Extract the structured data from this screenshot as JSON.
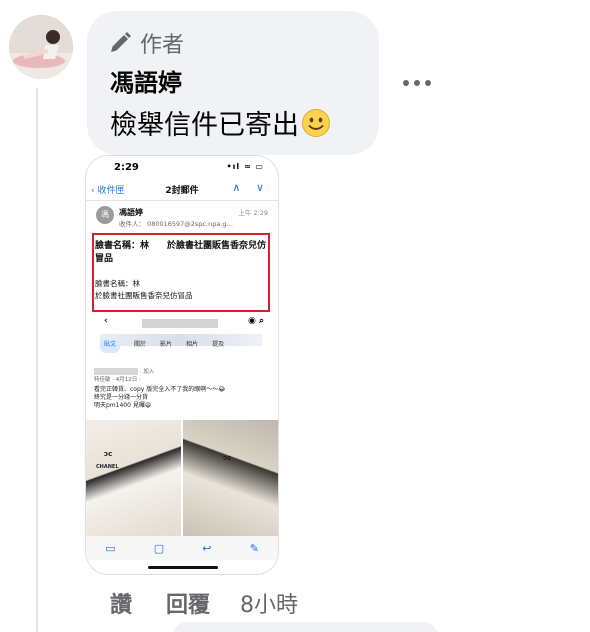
{
  "comment": {
    "author_badge": "作者",
    "author_badge_icon": "pencil-icon",
    "commenter_name": "馮語婷",
    "text": "檢舉信件已寄出",
    "emoji": "smiling-face-emoji",
    "more_icon": "more-horizontal-icon",
    "like_label": "讚",
    "reply_label": "回覆",
    "timestamp": "8小時"
  },
  "attachment": {
    "status_time": "2:29",
    "status_icons": "•ıl ≈ ▭",
    "nav_back": "收件匣",
    "nav_title": "2封郵件",
    "nav_arrows": "∧ ∨",
    "sender_initial": "馮",
    "sender": "馮語婷",
    "recipient": "收件人： 080016597@2spc.npa.g…",
    "mail_time": "上午 2:29",
    "subject": "臉書名稱：林　　於臉書社團販售香奈兒仿冒品",
    "body_line1": "臉書名稱：林",
    "body_line2": "於臉書社團販售香奈兒仿冒品",
    "fb_tabs": [
      "貼文",
      "關於",
      "影片",
      "相片",
      "提及"
    ],
    "post_meta": "· 加入",
    "post_sub": "特佳敏 · 4月12日 ·",
    "post_lines": [
      "看完正韓貨、copy 版完全入不了我的眼啊～～😂",
      "終究是一分錢一分貨",
      "明天pm1400 見囉😆"
    ],
    "photo_logo": "CHANEL",
    "accent_color": "#1a73e8",
    "highlight_color": "#d8202a"
  },
  "colors": {
    "bubble": "#f0f2f5",
    "secondary_text": "#65676b",
    "primary_text": "#050505"
  }
}
